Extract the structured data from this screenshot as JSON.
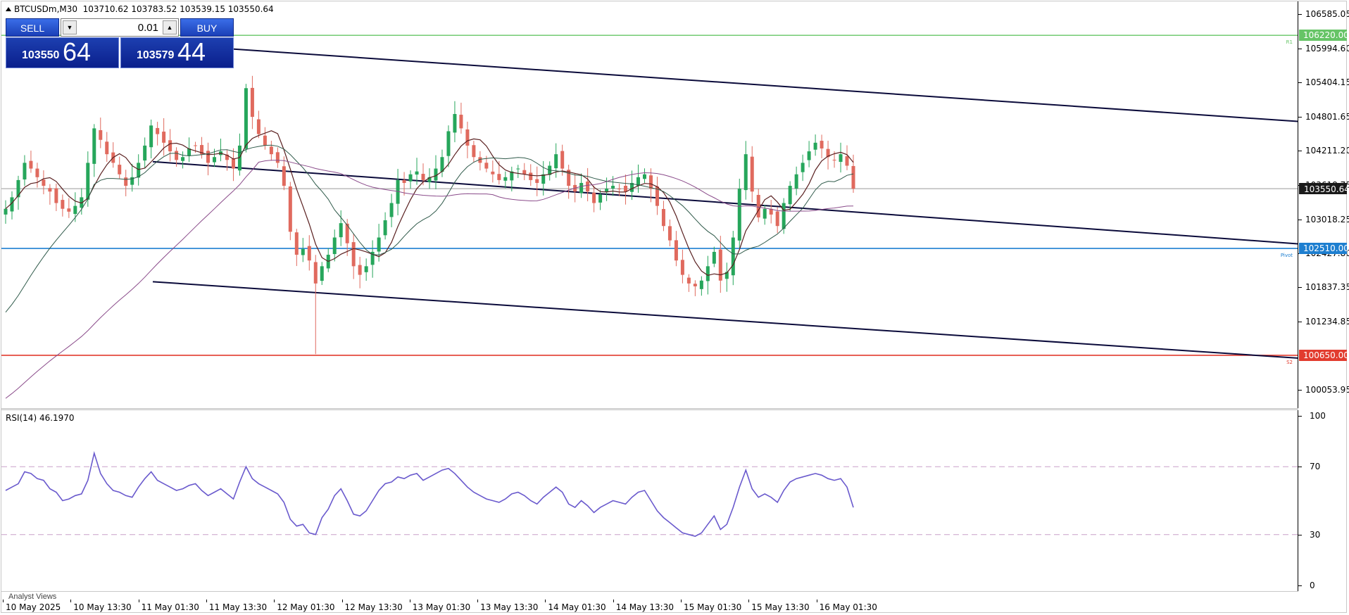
{
  "symbol": {
    "name": "BTCUSDm,M30",
    "ohlc": "103710.62 103783.52 103539.15 103550.64"
  },
  "trade_panel": {
    "sell_label": "SELL",
    "buy_label": "BUY",
    "lot": "0.01",
    "sell_price_small": "103550",
    "sell_price_big": "64",
    "buy_price_small": "103579",
    "buy_price_big": "44"
  },
  "price_axis": {
    "labels": [
      "106585.05",
      "105994.60",
      "105404.15",
      "104801.65",
      "104211.20",
      "103618.75",
      "103018.25",
      "102427.80",
      "101837.35",
      "101234.85",
      "100053.95"
    ],
    "label_values": [
      106585.05,
      105994.6,
      105404.15,
      104801.65,
      104211.2,
      103618.75,
      103018.25,
      102427.8,
      101837.35,
      101234.85,
      100053.95
    ],
    "range": [
      99730,
      106810
    ]
  },
  "levels": {
    "r1": {
      "value": "106220.00",
      "price": 106220.0,
      "label": "R1",
      "color": "#66c466"
    },
    "pivot": {
      "value": "102510.00",
      "price": 102510.0,
      "label": "Pivot",
      "color": "#1e7fd0"
    },
    "s2": {
      "value": "100650.00",
      "price": 100650.0,
      "label": "S2",
      "color": "#e23b2e"
    },
    "current": {
      "value": "103550.64",
      "price": 103550.64,
      "color": "#1a1a1a"
    }
  },
  "rsi": {
    "title": "RSI(14) 46.1970",
    "axis_labels": [
      "100",
      "70",
      "30",
      "0"
    ],
    "axis_values": [
      100,
      70,
      30,
      0
    ],
    "levels": [
      70,
      30
    ],
    "color": "#6a5acd"
  },
  "time_axis": {
    "labels": [
      "10 May 2025",
      "10 May 13:30",
      "11 May 01:30",
      "11 May 13:30",
      "12 May 01:30",
      "12 May 13:30",
      "13 May 01:30",
      "13 May 13:30",
      "14 May 01:30",
      "14 May 13:30",
      "15 May 01:30",
      "15 May 13:30",
      "16 May 01:30"
    ]
  },
  "bottom": {
    "analyst_views": "Analyst Views"
  },
  "colors": {
    "bull": "#26a65b",
    "bear": "#e06a5e",
    "ma_fast": "#5a2020",
    "ma_mid": "#2f5a4a",
    "ma_slow": "#8a4b8a",
    "channel": "#0a0a3a"
  },
  "chart_data": {
    "type": "candlestick",
    "timeframe": "M30",
    "series": [
      {
        "name": "BTCUSDm",
        "values": [
          103200,
          103400,
          103700,
          104000,
          103900,
          103750,
          103600,
          103500,
          103300,
          103200,
          103150,
          103250,
          103400,
          104000,
          104600,
          104400,
          104150,
          104000,
          103800,
          103600,
          103750,
          104000,
          104300,
          104650,
          104500,
          104350,
          104200,
          104050,
          104100,
          104250,
          104300,
          104150,
          104000,
          104100,
          104200,
          104050,
          103900,
          104300,
          105300,
          104800,
          104500,
          104300,
          104150,
          104000,
          103600,
          102800,
          102400,
          102500,
          102300,
          101900,
          102200,
          102400,
          102700,
          102950,
          102600,
          102200,
          102050,
          102200,
          102450,
          102700,
          103000,
          103300,
          103700,
          103650,
          103800,
          103850,
          103700,
          103750,
          103900,
          104100,
          104550,
          104850,
          104600,
          104300,
          104100,
          104000,
          103900,
          103800,
          103700,
          103750,
          103850,
          103900,
          103800,
          103700,
          103650,
          103800,
          103950,
          104150,
          103900,
          103600,
          103500,
          103650,
          103500,
          103300,
          103450,
          103550,
          103600,
          103550,
          103500,
          103650,
          103750,
          103800,
          103550,
          103250,
          102900,
          102650,
          102300,
          102050,
          101900,
          101850,
          101950,
          102200,
          102450,
          101950,
          102100,
          102700,
          103550,
          104150,
          103500,
          103050,
          103200,
          103100,
          102900,
          103300,
          103600,
          103800,
          104000,
          104200,
          104350,
          104250,
          104100,
          104050,
          104150,
          103950,
          103550
        ]
      }
    ],
    "rsi_values": [
      56,
      58,
      60,
      67,
      66,
      63,
      62,
      57,
      55,
      50,
      51,
      53,
      54,
      62,
      78,
      66,
      60,
      56,
      55,
      53,
      52,
      58,
      63,
      67,
      62,
      60,
      58,
      56,
      57,
      59,
      60,
      56,
      53,
      55,
      57,
      54,
      51,
      61,
      70,
      63,
      60,
      58,
      56,
      54,
      49,
      39,
      35,
      36,
      31,
      30,
      40,
      45,
      53,
      57,
      50,
      42,
      41,
      44,
      50,
      56,
      60,
      61,
      64,
      63,
      65,
      66,
      62,
      64,
      66,
      68,
      69,
      66,
      62,
      58,
      55,
      53,
      51,
      50,
      49,
      51,
      54,
      55,
      53,
      50,
      48,
      52,
      55,
      58,
      55,
      48,
      46,
      50,
      47,
      43,
      46,
      48,
      50,
      49,
      48,
      52,
      55,
      56,
      50,
      44,
      40,
      37,
      34,
      31,
      30,
      29,
      31,
      36,
      41,
      33,
      36,
      46,
      58,
      68,
      57,
      52,
      54,
      52,
      49,
      56,
      61,
      63,
      64,
      65,
      66,
      65,
      63,
      62,
      63,
      58,
      46
    ]
  }
}
